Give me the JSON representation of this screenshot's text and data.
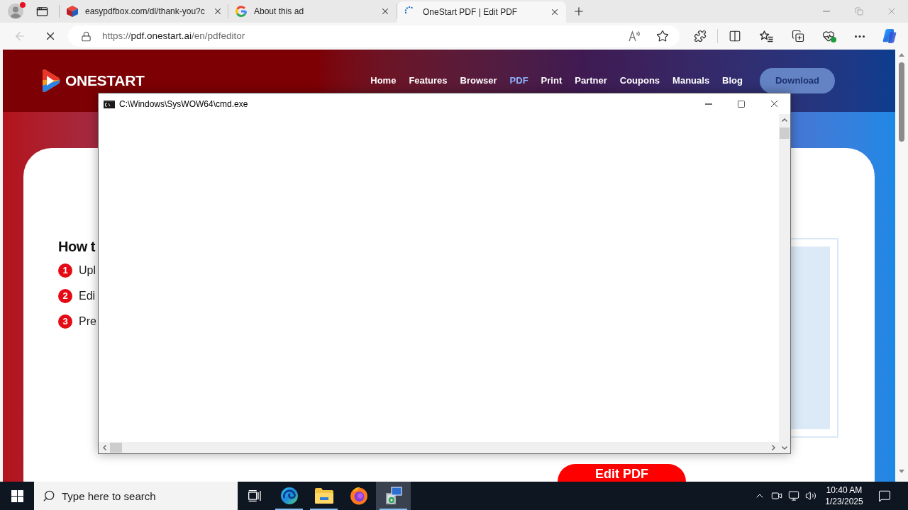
{
  "browser": {
    "profile": {
      "notification": true
    },
    "tabs": [
      {
        "title": "easypdfbox.com/dl/thank-you?c",
        "kind": "cube",
        "selected": false
      },
      {
        "title": "About this ad",
        "kind": "letter-g",
        "selected": false
      },
      {
        "title": "OneStart PDF | Edit PDF",
        "kind": "spinner",
        "selected": true
      }
    ],
    "toolbar": {
      "back_disabled": true,
      "loading": true
    },
    "address": {
      "scheme": "https://",
      "host": "pdf.onestart.ai",
      "path": "/en/pdfeditor"
    }
  },
  "page": {
    "logo": "ONESTART",
    "nav": [
      {
        "label": "Home",
        "selected": false
      },
      {
        "label": "Features",
        "selected": false
      },
      {
        "label": "Browser",
        "selected": false
      },
      {
        "label": "PDF",
        "selected": true
      },
      {
        "label": "Print",
        "selected": false
      },
      {
        "label": "Partner",
        "selected": false
      },
      {
        "label": "Coupons",
        "selected": false
      },
      {
        "label": "Manuals",
        "selected": false
      },
      {
        "label": "Blog",
        "selected": false
      }
    ],
    "download_button": "Download",
    "heading": "How t",
    "steps": [
      {
        "number": "1",
        "text": "Upl"
      },
      {
        "number": "2",
        "text": "Edi"
      },
      {
        "number": "3",
        "text": "Pre"
      }
    ],
    "edit_button": "Edit PDF"
  },
  "cmd_window": {
    "title": "C:\\Windows\\SysWOW64\\cmd.exe"
  },
  "taskbar": {
    "search_placeholder": "Type here to search",
    "apps": [
      {
        "kind": "edge",
        "running": true,
        "selected": false
      },
      {
        "kind": "file-explorer",
        "running": true,
        "selected": false
      },
      {
        "kind": "firefox",
        "running": false,
        "selected": false
      },
      {
        "kind": "installer",
        "running": true,
        "selected": true
      }
    ],
    "clock": {
      "time": "10:40 AM",
      "date": "1/23/2025"
    }
  }
}
